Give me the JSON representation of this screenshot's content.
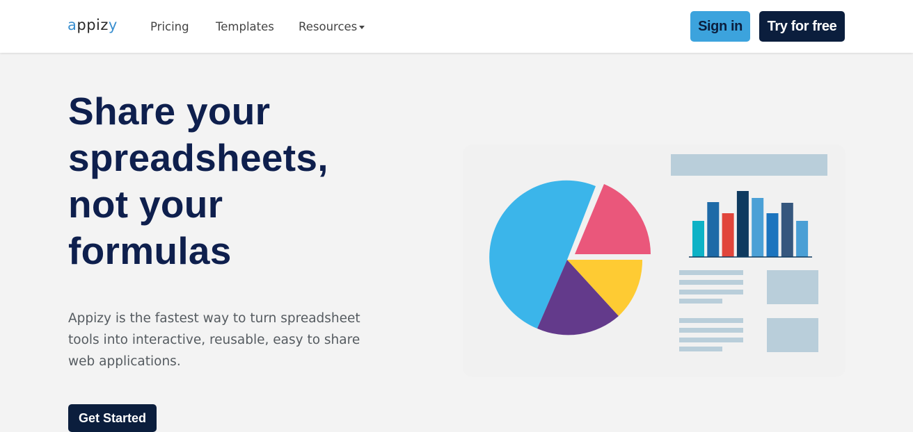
{
  "nav": {
    "logo_a": "a",
    "logo_rest": "ppiz",
    "logo_y": "y",
    "links": [
      "Pricing",
      "Templates",
      "Resources"
    ],
    "signin_label": "Sign in",
    "try_label": "Try for free"
  },
  "hero": {
    "title_lines": [
      "Share your",
      "spreadsheets,",
      "not your",
      "formulas"
    ],
    "description": "Appizy is the fastest way to turn spreadsheet tools into interactive, reusable, easy to share web applications.",
    "cta_label": "Get Started"
  },
  "colors": {
    "navy": "#0b1e3d",
    "accent_blue": "#3ca3dd",
    "pie": [
      "#3bb5ea",
      "#ea577b",
      "#fecb33",
      "#633a8b"
    ],
    "bars": [
      "#0eb2c6",
      "#1e6aa7",
      "#e1453b",
      "#0f3a5f",
      "#4ba0d6",
      "#1c74be",
      "#36577e",
      "#4a9fd5"
    ],
    "placeholder": "#b9ceda"
  },
  "illustration": {
    "icon": "chart-dashboard-illustration"
  }
}
